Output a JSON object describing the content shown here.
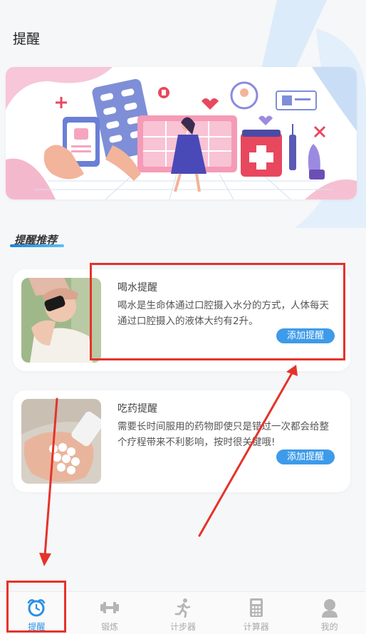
{
  "header": {
    "title": "提醒"
  },
  "section": {
    "title": "提醒推荐"
  },
  "cards": [
    {
      "title": "喝水提醒",
      "description": "喝水是生命体通过口腔摄入水分的方式，人体每天通过口腔摄入的液体大约有2升。",
      "button_label": "添加提醒"
    },
    {
      "title": "吃药提醒",
      "description": "需要长时间服用的药物即使只是错过一次都会给整个疗程带来不利影响，按时很关键哦!",
      "button_label": "添加提醒"
    }
  ],
  "tabbar": {
    "tabs": [
      {
        "label": "提醒",
        "icon": "alarm-clock-icon",
        "active": true
      },
      {
        "label": "锻炼",
        "icon": "dumbbell-icon",
        "active": false
      },
      {
        "label": "计步器",
        "icon": "running-person-icon",
        "active": false
      },
      {
        "label": "计算器",
        "icon": "calculator-icon",
        "active": false
      },
      {
        "label": "我的",
        "icon": "user-icon",
        "active": false
      }
    ]
  },
  "colors": {
    "accent": "#3d9be9",
    "active_tab": "#2a8fe5",
    "annotation": "#e5332a",
    "page_background": "#f6f7f9"
  }
}
